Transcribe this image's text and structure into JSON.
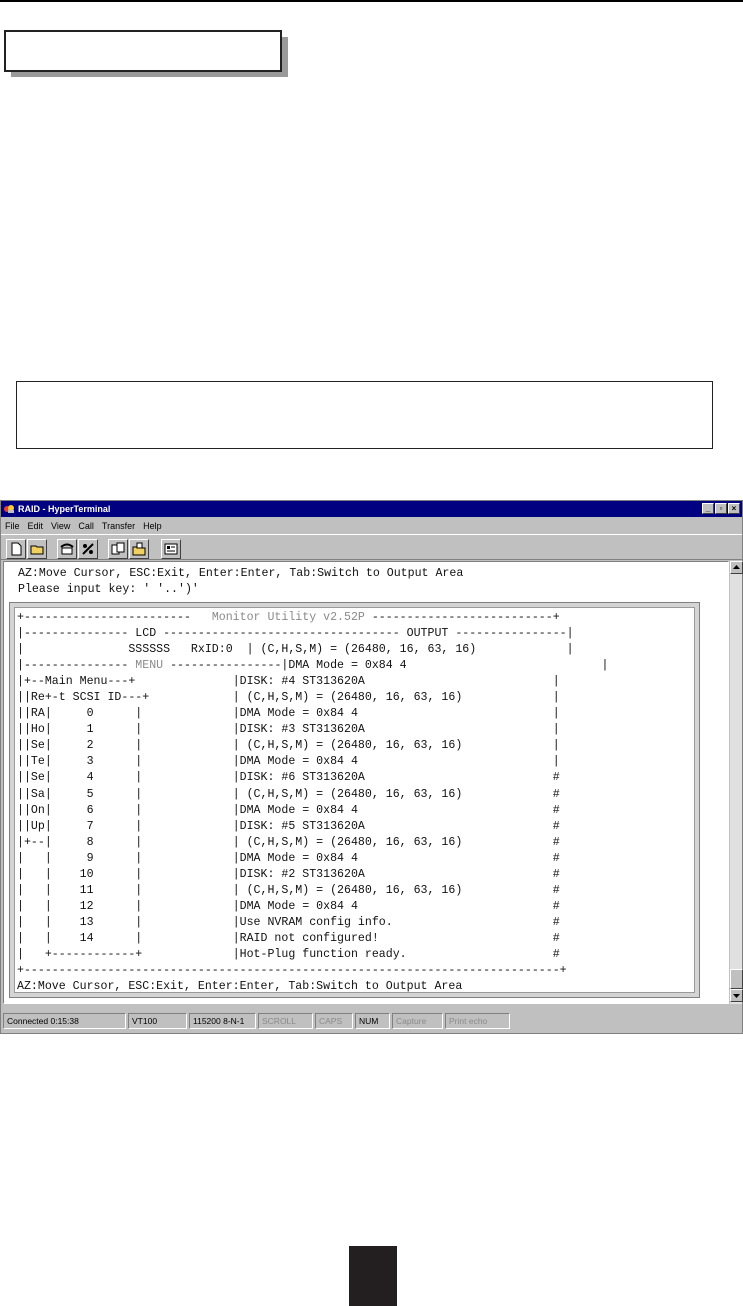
{
  "window": {
    "title": "RAID - HyperTerminal",
    "buttons": {
      "minimize": "_",
      "maximize": "▫",
      "close": "×"
    }
  },
  "menu": [
    "File",
    "Edit",
    "View",
    "Call",
    "Transfer",
    "Help"
  ],
  "toolbar": {
    "buttons": [
      "new-document-icon",
      "open-folder-icon",
      "phone-connect-icon",
      "disconnect-icon",
      "send-file-icon",
      "receive-file-icon",
      "properties-icon"
    ]
  },
  "terminal": {
    "header_line1": "AZ:Move Cursor, ESC:Exit, Enter:Enter, Tab:Switch to Output Area",
    "header_line2": "Please input key: ' '..')'",
    "border_top_left": "+------------------------   ",
    "utility_title": "Monitor Utility v2.52P",
    "border_top_right": " --------------------------+",
    "lcd_line": "|--------------- LCD ---------------------------------- OUTPUT ----------------|",
    "disk_row": "|               SSSSSS   RxID:0  | (C,H,S,M) = (26480, 16, 63, 16)             |",
    "menu_divider_left": "|--------------- ",
    "menu_word": "MENU",
    "menu_divider_right": " ----------------|DMA Mode = 0x84 4                            |",
    "rows": [
      {
        "left": "|+--Main Menu---+              ",
        "output": "|DISK: #4 ST313620A                           |"
      },
      {
        "left": "||Re+-t SCSI ID---+            ",
        "output": "| (C,H,S,M) = (26480, 16, 63, 16)             |"
      },
      {
        "left": "||RA|     0      |             ",
        "output": "|DMA Mode = 0x84 4                            |"
      },
      {
        "left": "||Ho|     1      |             ",
        "output": "|DISK: #3 ST313620A                           |"
      },
      {
        "left": "||Se|     2      |             ",
        "output": "| (C,H,S,M) = (26480, 16, 63, 16)             |"
      },
      {
        "left": "||Te|     3      |             ",
        "output": "|DMA Mode = 0x84 4                            |"
      },
      {
        "left": "||Se|     4      |             ",
        "output": "|DISK: #6 ST313620A                           #"
      },
      {
        "left": "||Sa|     5      |             ",
        "output": "| (C,H,S,M) = (26480, 16, 63, 16)             #"
      },
      {
        "left": "||On|     6      |             ",
        "output": "|DMA Mode = 0x84 4                            #"
      },
      {
        "left": "||Up|     7      |             ",
        "output": "|DISK: #5 ST313620A                           #"
      },
      {
        "left": "|+--|     8      |             ",
        "output": "| (C,H,S,M) = (26480, 16, 63, 16)             #"
      },
      {
        "left": "|   |     9      |             ",
        "output": "|DMA Mode = 0x84 4                            #"
      },
      {
        "left": "|   |    10      |             ",
        "output": "|DISK: #2 ST313620A                           #"
      },
      {
        "left": "|   |    11      |             ",
        "output": "| (C,H,S,M) = (26480, 16, 63, 16)             #"
      },
      {
        "left": "|   |    12      |             ",
        "output": "|DMA Mode = 0x84 4                            #"
      },
      {
        "left": "|   |    13      |             ",
        "output": "|Use NVRAM config info.                       #"
      },
      {
        "left": "|   |    14      |             ",
        "output": "|RAID not configured!                         #"
      },
      {
        "left": "|   +------------+             ",
        "output": "|Hot-Plug function ready.                     #"
      }
    ],
    "border_bottom": "+-----------------------------------------------------------------------------+",
    "footer": "AZ:Move Cursor, ESC:Exit, Enter:Enter, Tab:Switch to Output Area"
  },
  "statusbar": {
    "connected": "Connected 0:15:38",
    "emulation": "VT100",
    "port_settings": "115200 8-N-1",
    "scroll": "SCROLL",
    "caps": "CAPS",
    "num": "NUM",
    "capture": "Capture",
    "print_echo": "Print echo"
  }
}
